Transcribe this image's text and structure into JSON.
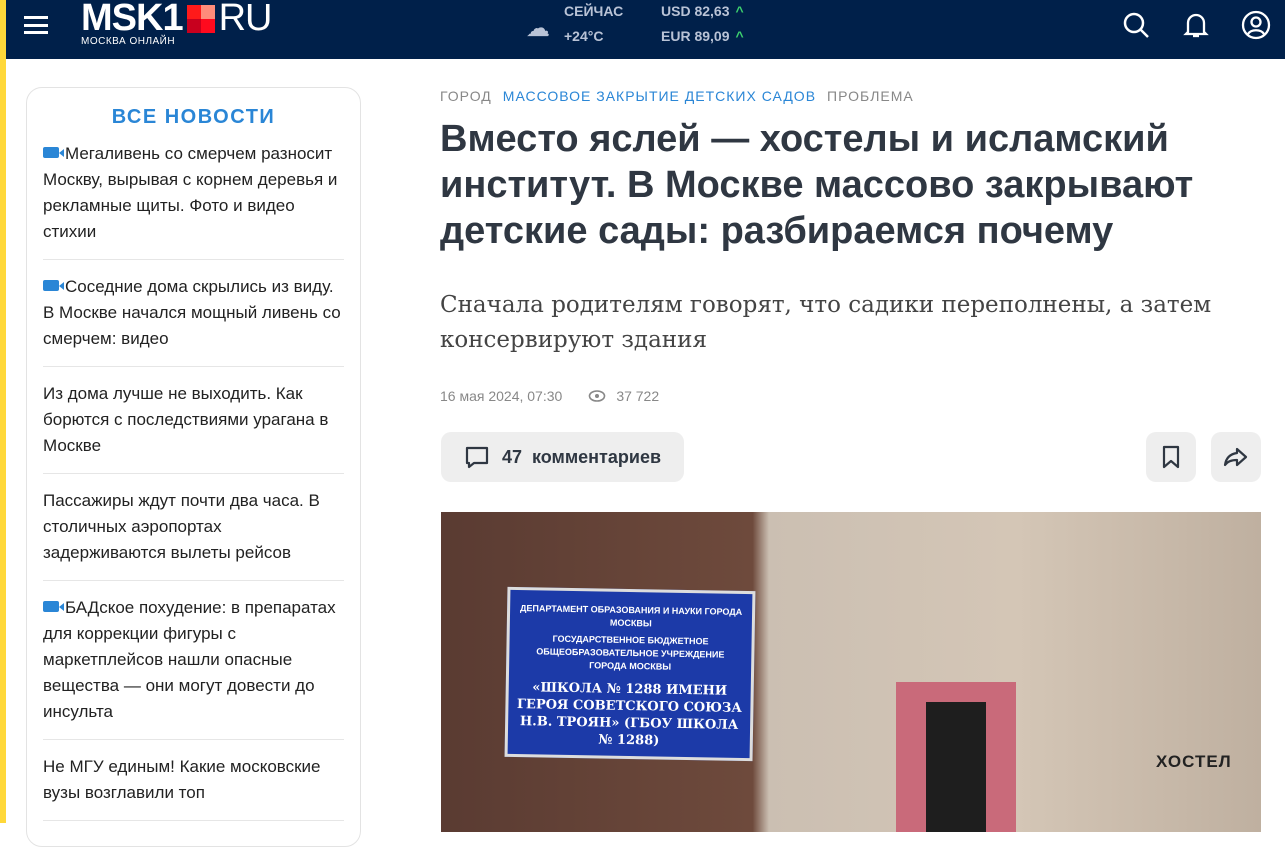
{
  "header": {
    "logo": "MSK1",
    "logo_suffix": "RU",
    "tagline": "МОСКВА ОНЛАЙН",
    "weather_label": "СЕЙЧАС",
    "temperature": "+24°C",
    "usd": "USD 82,63",
    "eur": "EUR 89,09",
    "colors": {
      "bg": "#00204a",
      "accent": "#ff0000"
    }
  },
  "sidebar": {
    "title": "ВСЕ НОВОСТИ",
    "items": [
      {
        "text": "Мегаливень со смерчем разносит Москву, вырывая с корнем деревья и рекламные щиты. Фото и видео стихии",
        "video": true
      },
      {
        "text": "Соседние дома скрылись из виду. В Москве начался мощный ливень со смерчем: видео",
        "video": true
      },
      {
        "text": "Из дома лучше не выходить. Как борются с последствиями урагана в Москве",
        "video": false
      },
      {
        "text": "Пассажиры ждут почти два часа. В столичных аэропортах задерживаются вылеты рейсов",
        "video": false
      },
      {
        "text": "БАДское похудение: в препаратах для коррекции фигуры с маркетплейсов нашли опасные вещества — они могут довести до инсульта",
        "video": true
      },
      {
        "text": "Не МГУ единым! Какие московские вузы возглавили топ",
        "video": false
      }
    ]
  },
  "article": {
    "crumbs": [
      "ГОРОД",
      "МАССОВОЕ ЗАКРЫТИЕ ДЕТСКИХ САДОВ",
      "ПРОБЛЕМА"
    ],
    "title": "Вместо яслей — хостелы и исламский институт. В Москве массово закрывают детские сады: разбираемся почему",
    "lead": "Сначала родителям говорят, что садики переполнены, а затем консервируют здания",
    "date": "16 мая 2024, 07:30",
    "views": "37 722",
    "comments_count": "47",
    "comments_label": "комментариев"
  },
  "photo": {
    "sign_top": "ДЕПАРТАМЕНТ ОБРАЗОВАНИЯ И НАУКИ ГОРОДА МОСКВЫ",
    "sign_mid": "ГОСУДАРСТВЕННОЕ БЮДЖЕТНОЕ ОБЩЕОБРАЗОВАТЕЛЬНОЕ УЧРЕЖДЕНИЕ ГОРОДА МОСКВЫ",
    "sign_main": "«ШКОЛА № 1288 ИМЕНИ ГЕРОЯ СОВЕТСКОГО СОЮЗА Н.В. ТРОЯН» (ГБОУ ШКОЛА № 1288)",
    "hostel": "ХОСТЕЛ"
  }
}
